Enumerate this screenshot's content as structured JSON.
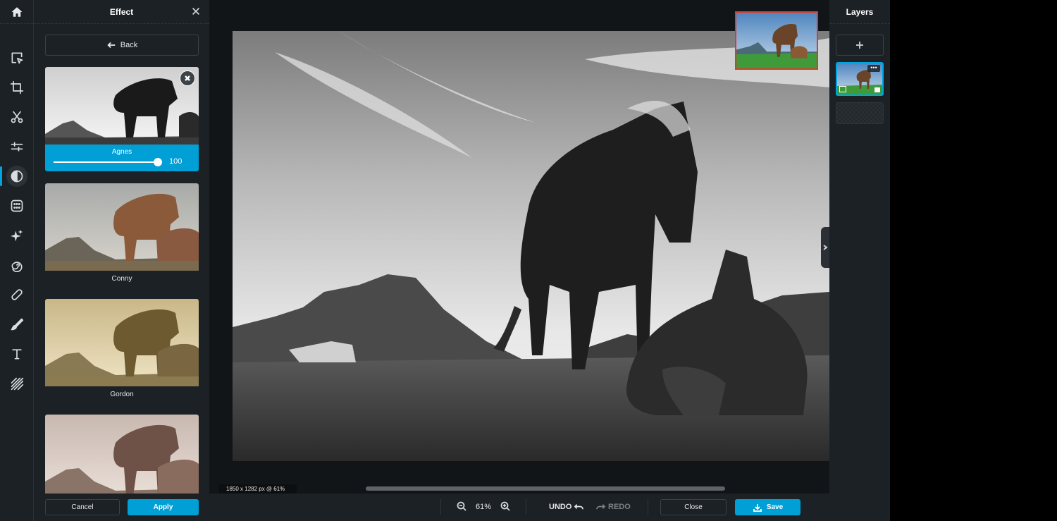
{
  "effect_panel": {
    "title": "Effect",
    "back_label": "Back",
    "effects": [
      {
        "name": "Agnes",
        "selected": true,
        "intensity": "100",
        "style": "bw"
      },
      {
        "name": "Conny",
        "selected": false,
        "style": "warm"
      },
      {
        "name": "Gordon",
        "selected": false,
        "style": "sepia"
      },
      {
        "name": "",
        "selected": false,
        "style": "rose"
      }
    ],
    "cancel_label": "Cancel",
    "apply_label": "Apply"
  },
  "rail": {
    "tools": [
      "home-icon",
      "arrange-icon",
      "crop-icon",
      "cutout-icon",
      "adjust-icon",
      "effect-icon",
      "template-icon",
      "beautify-icon",
      "spiral-icon",
      "retouch-icon",
      "draw-icon",
      "text-icon",
      "texture-icon"
    ],
    "active": "effect-icon"
  },
  "canvas": {
    "size_label": "1850 x 1282 px @ 61%"
  },
  "bottom_bar": {
    "zoom": "61%",
    "undo_label": "UNDO",
    "redo_label": "REDO",
    "close_label": "Close",
    "save_label": "Save"
  },
  "layers_panel": {
    "title": "Layers",
    "more_label": "•••"
  },
  "colors": {
    "accent": "#009fd6",
    "panel_bg": "#1c2126",
    "canvas_bg": "#121518",
    "navigator_border": "#e0382a"
  }
}
